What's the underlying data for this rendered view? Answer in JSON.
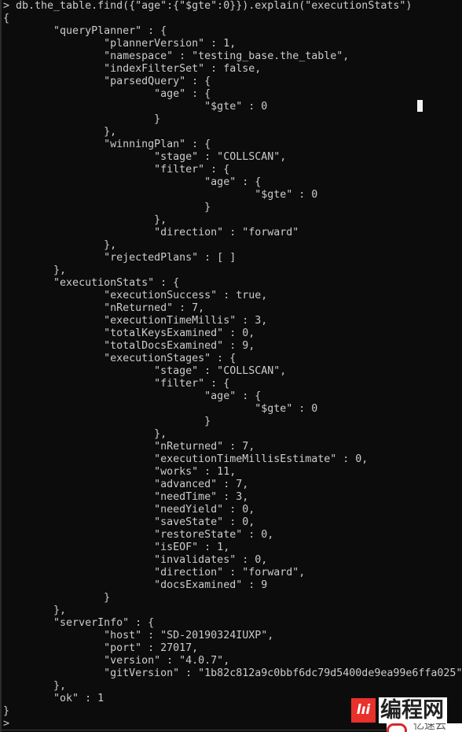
{
  "window": {
    "type": "console",
    "background_color": "#0c0c0c",
    "text_color": "#cccccc"
  },
  "console": {
    "lines": [
      "> db.the_table.find({\"age\":{\"$gte\":0}}).explain(\"executionStats\")",
      "{",
      "        \"queryPlanner\" : {",
      "                \"plannerVersion\" : 1,",
      "                \"namespace\" : \"testing_base.the_table\",",
      "                \"indexFilterSet\" : false,",
      "                \"parsedQuery\" : {",
      "                        \"age\" : {",
      "                                \"$gte\" : 0",
      "                        }",
      "                },",
      "                \"winningPlan\" : {",
      "                        \"stage\" : \"COLLSCAN\",",
      "                        \"filter\" : {",
      "                                \"age\" : {",
      "                                        \"$gte\" : 0",
      "                                }",
      "                        },",
      "                        \"direction\" : \"forward\"",
      "                },",
      "                \"rejectedPlans\" : [ ]",
      "        },",
      "        \"executionStats\" : {",
      "                \"executionSuccess\" : true,",
      "                \"nReturned\" : 7,",
      "                \"executionTimeMillis\" : 3,",
      "                \"totalKeysExamined\" : 0,",
      "                \"totalDocsExamined\" : 9,",
      "                \"executionStages\" : {",
      "                        \"stage\" : \"COLLSCAN\",",
      "                        \"filter\" : {",
      "                                \"age\" : {",
      "                                        \"$gte\" : 0",
      "                                }",
      "                        },",
      "                        \"nReturned\" : 7,",
      "                        \"executionTimeMillisEstimate\" : 0,",
      "                        \"works\" : 11,",
      "                        \"advanced\" : 7,",
      "                        \"needTime\" : 3,",
      "                        \"needYield\" : 0,",
      "                        \"saveState\" : 0,",
      "                        \"restoreState\" : 0,",
      "                        \"isEOF\" : 1,",
      "                        \"invalidates\" : 0,",
      "                        \"direction\" : \"forward\",",
      "                        \"docsExamined\" : 9",
      "                }",
      "        },",
      "        \"serverInfo\" : {",
      "                \"host\" : \"SD-20190324IUXP\",",
      "                \"port\" : 27017,",
      "                \"version\" : \"4.0.7\",",
      "                \"gitVersion\" : \"1b82c812a9c0bbf6dc79d5400de9ea99e6ffa025\"",
      "        },",
      "        \"ok\" : 1",
      "}",
      ">"
    ]
  },
  "watermark": {
    "logo_glyph": "lıi",
    "text": "编程网",
    "sub_text": "亿速云",
    "brand_color": "#e8312b"
  }
}
